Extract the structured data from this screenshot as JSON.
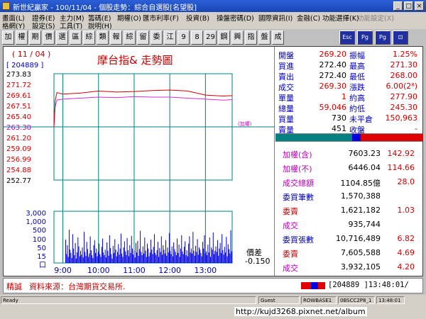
{
  "window": {
    "title": "新世紀贏家 - 100/11/04 - 個股走勢：綜合自選股[名望股]"
  },
  "menu": {
    "row1": [
      "畫面(L)",
      "證券(E)",
      "主力(M)",
      "籌碼(E)",
      "期權(O)",
      "匯市利率(F)",
      "投資(B)",
      "操盤密碼(D)",
      "國際資訊(I)",
      "金融(C)",
      "功能選擇(K)",
      "功能設定(X)"
    ],
    "row2": [
      "格網(Y)",
      "設定(S)",
      "工具(T)",
      "說明(H)"
    ]
  },
  "toolbar": {
    "buttons": [
      "加",
      "權",
      "期",
      "價",
      "選",
      "區",
      "綜",
      "類",
      "報",
      "綜",
      "留",
      "委",
      "江",
      "9",
      "8",
      "29",
      "鋼",
      "興",
      "指",
      "盤",
      "成"
    ]
  },
  "chart_header": {
    "date": "( 11 / 04 )",
    "code": "[ 204889 ]",
    "title": "摩台指& 走勢圖"
  },
  "chart_data": {
    "type": "line",
    "y_ticks": [
      273.83,
      271.72,
      269.61,
      267.51,
      265.4,
      263.3,
      261.2,
      259.09,
      256.99,
      254.88,
      252.77
    ],
    "ylim": [
      252.77,
      273.83
    ],
    "reference_value": 263.3,
    "reference_label": "(加權)",
    "x_ticks": [
      "9:00",
      "10:00",
      "11:00",
      "12:00",
      "13:00"
    ],
    "volume_ticks": [
      "3,000",
      "1,000",
      "500",
      "100",
      "50",
      "15",
      "口"
    ],
    "price_series": [
      {
        "x": "08:45",
        "value": 263.3
      },
      {
        "x": "08:47",
        "value": 268.5
      },
      {
        "x": "08:50",
        "value": 270.1
      },
      {
        "x": "09:00",
        "value": 269.8
      },
      {
        "x": "09:30",
        "value": 270.0
      },
      {
        "x": "10:00",
        "value": 270.4
      },
      {
        "x": "10:30",
        "value": 270.2
      },
      {
        "x": "11:00",
        "value": 270.3
      },
      {
        "x": "11:30",
        "value": 270.5
      },
      {
        "x": "12:00",
        "value": 270.6
      },
      {
        "x": "12:30",
        "value": 270.4
      },
      {
        "x": "13:00",
        "value": 269.6
      },
      {
        "x": "13:30",
        "value": 269.4
      },
      {
        "x": "13:45",
        "value": 269.5
      }
    ],
    "index_series": [
      {
        "x": "08:45",
        "value": 263.3
      },
      {
        "x": "08:47",
        "value": 267.3
      },
      {
        "x": "08:50",
        "value": 268.6
      },
      {
        "x": "09:00",
        "value": 268.8
      },
      {
        "x": "09:30",
        "value": 269.0
      },
      {
        "x": "10:00",
        "value": 269.2
      },
      {
        "x": "10:30",
        "value": 269.1
      },
      {
        "x": "11:00",
        "value": 269.3
      },
      {
        "x": "11:30",
        "value": 269.2
      },
      {
        "x": "12:00",
        "value": 269.2
      },
      {
        "x": "12:30",
        "value": 269.0
      },
      {
        "x": "13:00",
        "value": 268.8
      },
      {
        "x": "13:30",
        "value": 268.6
      },
      {
        "x": "13:45",
        "value": 268.7
      }
    ],
    "volume_series": [
      210,
      80,
      160,
      55,
      300,
      120,
      90,
      45,
      260,
      130,
      70,
      180,
      40,
      95,
      230,
      150,
      60,
      110,
      75,
      140,
      50,
      280,
      100,
      65,
      190,
      125,
      55,
      85,
      240,
      115,
      70,
      45,
      160,
      205,
      90,
      130,
      60,
      100,
      175,
      80,
      55,
      145,
      220,
      95,
      70,
      120,
      50,
      185,
      110,
      65,
      250,
      135,
      80,
      40,
      155,
      90,
      215,
      120,
      60,
      100,
      170,
      75,
      130,
      265,
      85,
      55,
      140,
      195,
      105,
      70,
      225,
      115,
      60,
      160,
      90,
      245,
      130,
      75,
      110,
      50,
      180,
      95,
      200,
      65,
      125,
      290,
      100,
      70,
      150,
      85,
      230,
      110,
      55,
      175,
      130,
      60,
      95,
      210,
      120,
      80,
      145,
      260,
      90,
      70,
      115,
      190,
      55,
      135,
      100,
      240,
      75,
      160,
      120,
      85,
      205,
      65,
      140,
      95,
      270,
      110,
      80,
      150,
      60,
      185,
      125,
      100,
      70,
      220,
      90,
      165,
      55,
      130,
      250,
      105,
      80,
      145,
      195,
      70,
      115,
      60,
      175,
      240,
      95,
      130,
      85,
      280,
      110,
      65,
      155,
      100,
      215,
      75,
      140,
      120,
      90,
      60,
      190,
      130,
      250,
      85,
      105,
      70,
      165,
      95,
      230,
      55,
      140,
      120,
      275,
      80,
      110,
      150,
      100,
      205,
      65,
      130,
      180,
      90,
      260,
      115,
      75,
      145,
      95,
      235,
      60,
      170,
      125,
      85,
      295,
      105
    ]
  },
  "spread": {
    "label": "價差",
    "value": "-0.150"
  },
  "quote": [
    {
      "l1": "開盤",
      "v1": "269.20",
      "l2": "振幅",
      "v2": "1.25%"
    },
    {
      "l1": "買進",
      "v1": "272.40",
      "l2": "最高",
      "v2": "271.30"
    },
    {
      "l1": "賣出",
      "v1": "272.40",
      "l2": "最低",
      "v2": "268.00"
    },
    {
      "l1": "成交",
      "v1": "269.30",
      "l2": "漲跌",
      "v2": "6.00(2⁸)"
    },
    {
      "l1": "單量",
      "v1": "1",
      "l2": "約高",
      "v2": "277.90"
    },
    {
      "l1": "總量",
      "v1": "59,046",
      "l2": "約低",
      "v2": "245.30"
    },
    {
      "l1": "買量",
      "v1": "730",
      "l2": "未平倉",
      "v2": "150,963"
    },
    {
      "l1": "賣量",
      "v1": "451",
      "l2": "收盤",
      "v2": "-"
    }
  ],
  "market": [
    {
      "label": "加權(含)",
      "value": "7603.23",
      "change": "142.92"
    },
    {
      "label": "加權(不)",
      "value": "6446.04",
      "change": "114.66"
    },
    {
      "label": "成交總額",
      "value": "1104.85億",
      "change": "28.0"
    },
    {
      "label": "委買筆數",
      "value": "1,570,388",
      "change": ""
    },
    {
      "label": "委賣",
      "value": "1,621,182",
      "change": "1.03"
    },
    {
      "label": "成交",
      "value": "935,744",
      "change": ""
    },
    {
      "label": "委買張數",
      "value": "10,716,489",
      "change": "6.82"
    },
    {
      "label": "委賣",
      "value": "7,605,588",
      "change": "4.69"
    },
    {
      "label": "成交",
      "value": "3,932,105",
      "change": "4.20"
    }
  ],
  "bottom": {
    "tab": "精誠",
    "source": "資料來源：台灣期貨交易所.",
    "code_time": "[204889 ]13:48:01/"
  },
  "status": {
    "ready": "Ready",
    "user": "Guest",
    "server": "ROWBASE1",
    "id": "0BSCC2P8_1",
    "time": "13:48:01",
    "url": "http://kujd3268.pixnet.net/album"
  },
  "colors": {
    "price_line": "#d00000",
    "index_line": "#d030d0",
    "volume_bar": "#0000e0",
    "grid": "#008080",
    "up": "#d00000",
    "label_blue": "#0000c0"
  }
}
